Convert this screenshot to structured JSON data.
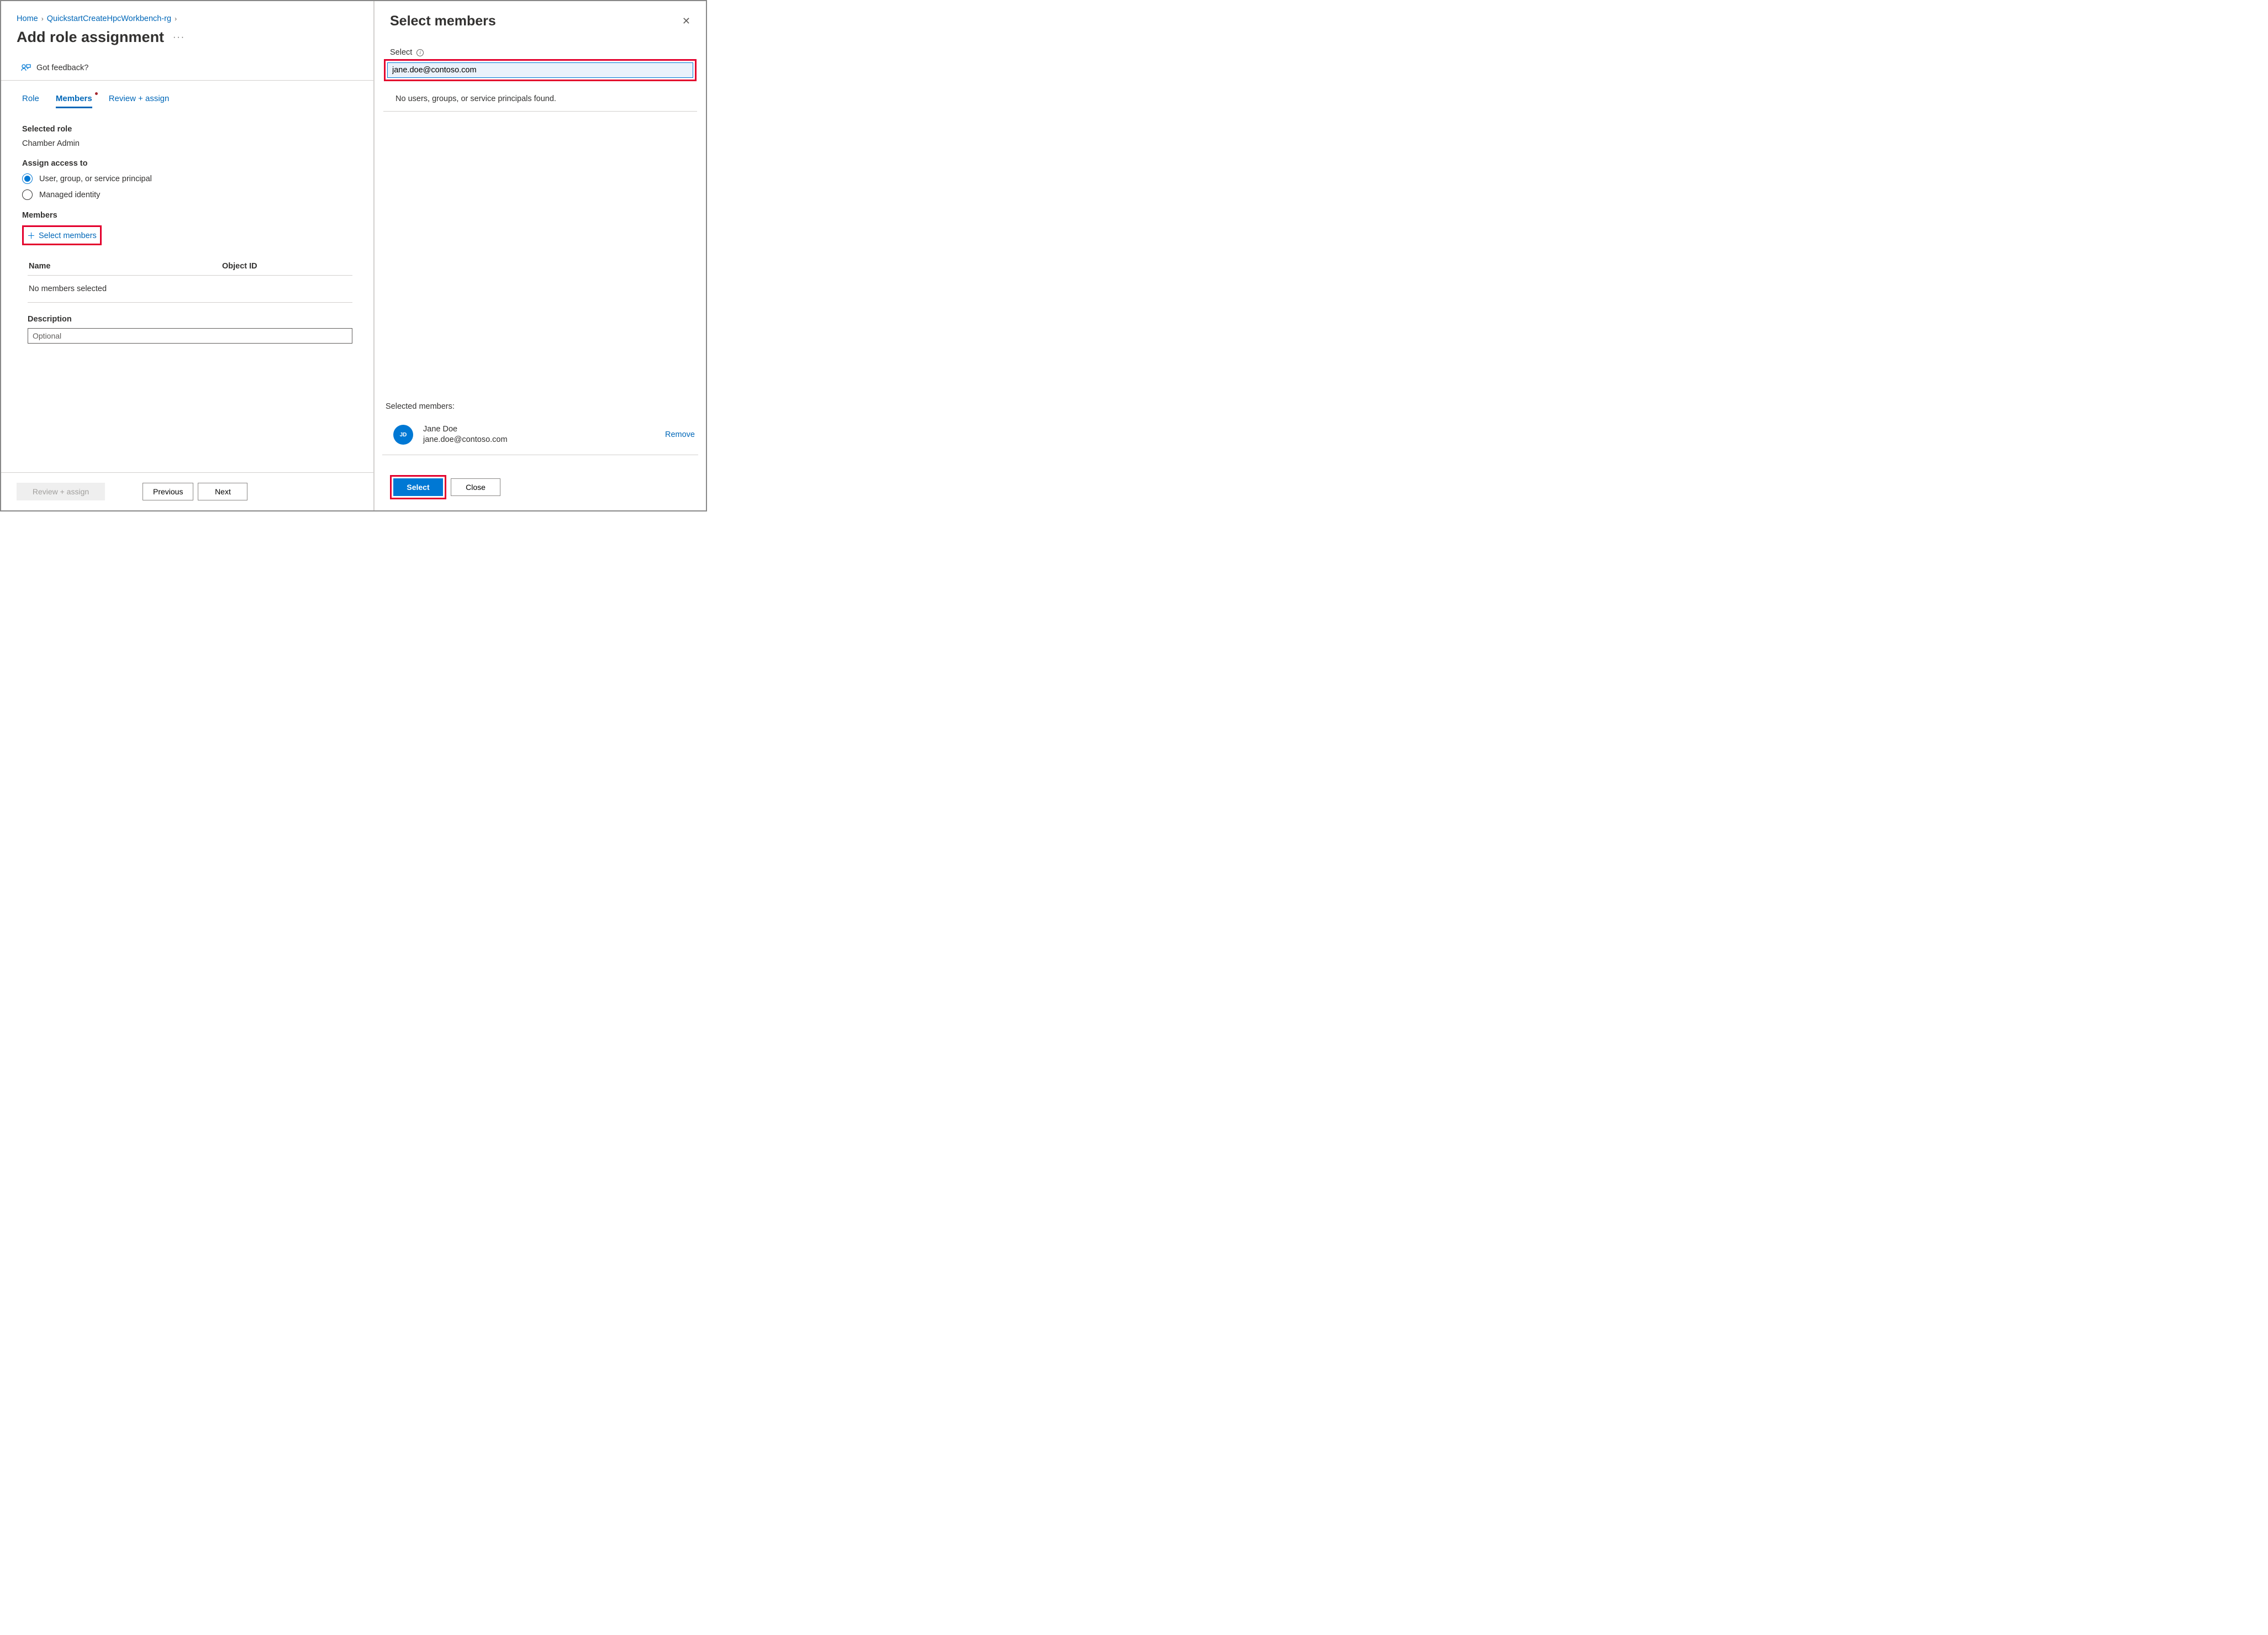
{
  "breadcrumb": {
    "home": "Home",
    "rg": "QuickstartCreateHpcWorkbench-rg"
  },
  "page": {
    "title": "Add role assignment",
    "more": "···",
    "feedback": "Got feedback?"
  },
  "tabs": {
    "role": "Role",
    "members": "Members",
    "review": "Review + assign"
  },
  "form": {
    "selected_role_label": "Selected role",
    "selected_role_value": "Chamber Admin",
    "assign_access_label": "Assign access to",
    "radio_user": "User, group, or service principal",
    "radio_managed": "Managed identity",
    "members_label": "Members",
    "select_members_link": "Select members",
    "table": {
      "name_header": "Name",
      "objectid_header": "Object ID",
      "empty": "No members selected"
    },
    "description_label": "Description",
    "description_placeholder": "Optional"
  },
  "bottom": {
    "review_assign": "Review + assign",
    "previous": "Previous",
    "next": "Next"
  },
  "panel": {
    "title": "Select members",
    "select_label": "Select",
    "search_value": "jane.doe@contoso.com",
    "no_results": "No users, groups, or service principals found.",
    "selected_label": "Selected members:",
    "member": {
      "initials": "JD",
      "name": "Jane Doe",
      "email": "jane.doe@contoso.com",
      "remove": "Remove"
    },
    "select_btn": "Select",
    "close_btn": "Close"
  }
}
